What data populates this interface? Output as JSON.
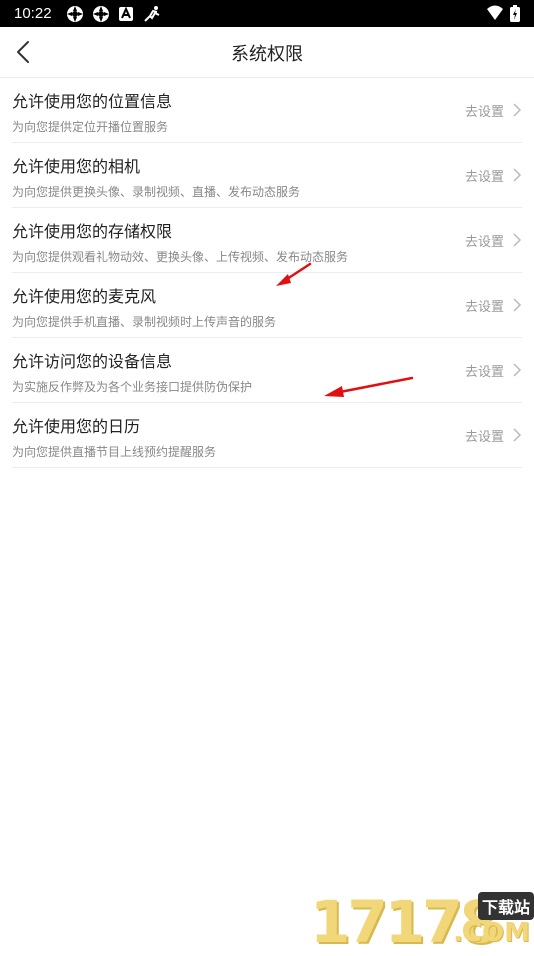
{
  "status": {
    "time": "10:22"
  },
  "header": {
    "title": "系统权限"
  },
  "items": [
    {
      "title": "允许使用您的位置信息",
      "desc": "为向您提供定位开播位置服务",
      "action": "去设置"
    },
    {
      "title": "允许使用您的相机",
      "desc": "为向您提供更换头像、录制视频、直播、发布动态服务",
      "action": "去设置"
    },
    {
      "title": "允许使用您的存储权限",
      "desc": "为向您提供观看礼物动效、更换头像、上传视频、发布动态服务",
      "action": "去设置"
    },
    {
      "title": "允许使用您的麦克风",
      "desc": "为向您提供手机直播、录制视频时上传声音的服务",
      "action": "去设置"
    },
    {
      "title": "允许访问您的设备信息",
      "desc": "为实施反作弊及为各个业务接口提供防伪保护",
      "action": "去设置"
    },
    {
      "title": "允许使用您的日历",
      "desc": "为向您提供直播节目上线预约提醒服务",
      "action": "去设置"
    }
  ],
  "watermark": {
    "number": "17178",
    "tag": "下载站",
    "suffix": ".COM"
  },
  "colors": {
    "annotation_arrow": "#e01010",
    "watermark": "#f2d77a"
  }
}
